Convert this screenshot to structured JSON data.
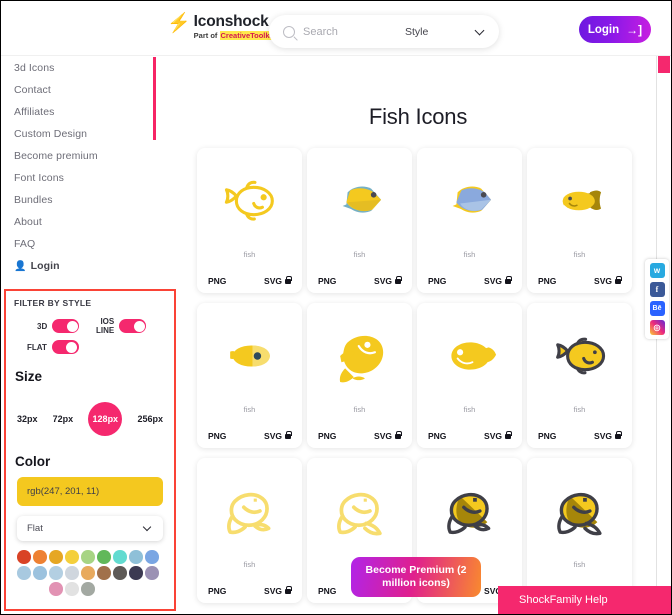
{
  "header": {
    "brand_name": "Iconshock",
    "brand_sub_prefix": "Part of ",
    "brand_sub_highlight": "CreativeToolkit",
    "bolt_icon": "lightning-bolt-icon",
    "search_placeholder": "Search",
    "search_value": "",
    "style_dropdown_label": "Style",
    "login_label": "Login",
    "login_arrow": "→]"
  },
  "sidebar": {
    "items": [
      {
        "label": "3d Icons"
      },
      {
        "label": "Contact"
      },
      {
        "label": "Affiliates"
      },
      {
        "label": "Custom Design"
      },
      {
        "label": "Become premium"
      },
      {
        "label": "Font Icons"
      },
      {
        "label": "Bundles"
      },
      {
        "label": "About"
      },
      {
        "label": "FAQ"
      }
    ],
    "login": {
      "label": "Login",
      "icon": "person-icon"
    }
  },
  "filter": {
    "title": "FILTER BY STYLE",
    "toggles": [
      {
        "label": "3D",
        "on": true
      },
      {
        "label": "IOS LINE",
        "label_line1": "IOS",
        "label_line2": "LINE",
        "on": true
      },
      {
        "label": "FLAT",
        "on": true
      }
    ],
    "size": {
      "title": "Size",
      "options": [
        "32px",
        "72px",
        "128px",
        "256px"
      ],
      "selected": "128px"
    },
    "color": {
      "title": "Color",
      "value": "rgb(247, 201, 11)",
      "value_hex": "#f4c91f",
      "style_select": "Flat",
      "swatches_row1": [
        "#d94326",
        "#ee8133",
        "#e6a723",
        "#f4cf3c",
        "#a7d484",
        "#61b85a",
        "#62dbd0",
        "#8fc0d8",
        "#7aa6e3"
      ],
      "swatches_row2": [
        "#a8c9e0",
        "#9cc2de",
        "#b3cfe2",
        "#cfd6de",
        "#e8aa5e",
        "#a1714b",
        "#5e5a57",
        "#3c3a52",
        "#9b91b4"
      ],
      "swatches_row3": [
        "#e292b3",
        "#e2e2e2",
        "#a3a9a2"
      ]
    }
  },
  "main": {
    "page_title": "Fish Icons",
    "png_label": "PNG",
    "svg_label": "SVG",
    "lock_icon": "lock-icon",
    "cards": [
      {
        "name": "fish",
        "style": "line-yellow"
      },
      {
        "name": "fish",
        "style": "flat-yellow-blue"
      },
      {
        "name": "fish",
        "style": "flat-blue-yellow"
      },
      {
        "name": "fish",
        "style": "flat-gold-dark"
      },
      {
        "name": "fish",
        "style": "flat-yellow-round"
      },
      {
        "name": "fish",
        "style": "flat-yellow-jumping"
      },
      {
        "name": "fish",
        "style": "flat-yellow-wide"
      },
      {
        "name": "fish",
        "style": "outline-dark-yellow"
      },
      {
        "name": "fish",
        "style": "line-light-yellow"
      },
      {
        "name": "fish",
        "style": "line-light-yellow-2"
      },
      {
        "name": "fish",
        "style": "outline-dark-gold"
      },
      {
        "name": "fish",
        "style": "outline-dark-gold-2"
      }
    ]
  },
  "social": {
    "items": [
      {
        "name": "twitter",
        "glyph": "✓"
      },
      {
        "name": "facebook",
        "glyph": "f"
      },
      {
        "name": "behance",
        "glyph": "Bė"
      },
      {
        "name": "instagram",
        "glyph": "◎"
      }
    ]
  },
  "floating": {
    "premium_label": "Become Premium (2 million icons)",
    "help_label": "ShockFamily Help"
  }
}
